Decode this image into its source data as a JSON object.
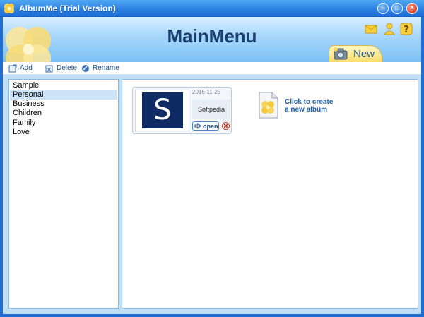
{
  "window": {
    "title": "AlbumMe (Trial Version)",
    "minimize": "–",
    "maximize": "□",
    "close": "×"
  },
  "header": {
    "title": "MainMenu",
    "new_tab_label": "New",
    "icons": [
      "mail-icon",
      "user-icon",
      "help-icon"
    ]
  },
  "toolbar": {
    "add_label": "Add",
    "delete_label": "Delete",
    "rename_label": "Rename"
  },
  "categories": {
    "items": [
      "Sample",
      "Personal",
      "Business",
      "Children",
      "Family",
      "Love"
    ],
    "selected": "Personal"
  },
  "album": {
    "thumb_letter": "S",
    "date": "2016-11-25",
    "name": "Softpedia",
    "open_label": "open"
  },
  "create": {
    "line1": "Click to create",
    "line2": "a new album"
  },
  "colors": {
    "titlebar": "#2a7ee0",
    "accent": "#1f5fa8",
    "selection": "#cde4f8",
    "workspace": "#bfe0f8"
  }
}
